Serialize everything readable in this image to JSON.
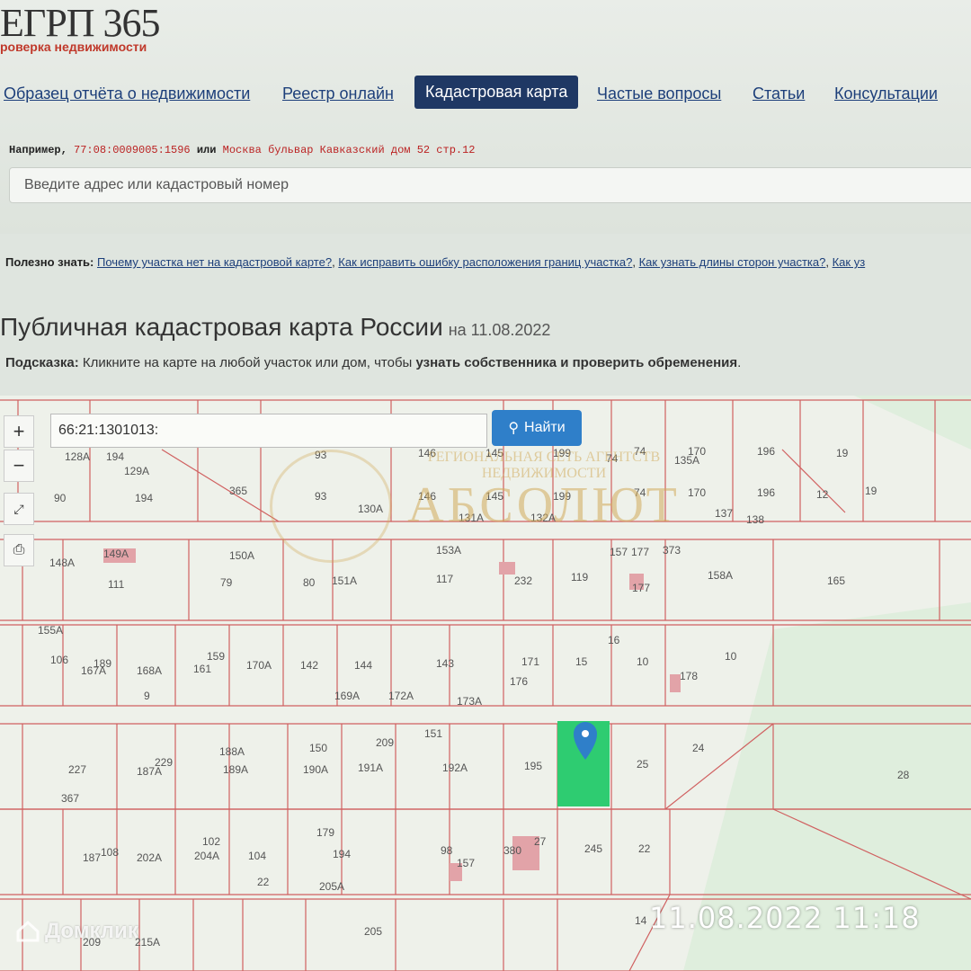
{
  "logo": {
    "title": "ЕГРП 365",
    "subtitle": "роверка недвижимости"
  },
  "nav": {
    "items": [
      {
        "label": "Образец отчёта о недвижимости"
      },
      {
        "label": "Реестр онлайн"
      },
      {
        "label": "Кадастровая карта"
      },
      {
        "label": "Частые вопросы"
      },
      {
        "label": "Статьи"
      },
      {
        "label": "Консультации"
      }
    ]
  },
  "example": {
    "prefix": "Например,",
    "code": "77:08:0009005:1596",
    "or": "или",
    "address": "Москва бульвар Кавказский дом 52 стр.12"
  },
  "search": {
    "placeholder": "Введите адрес или кадастровый номер"
  },
  "useful": {
    "label": "Полезно знать:",
    "links": [
      "Почему участка нет на кадастровой карте?",
      "Как исправить ошибку расположения границ участка?",
      "Как узнать длины сторон участка?",
      "Как уз"
    ]
  },
  "title": {
    "text": "Публичная кадастровая карта России",
    "date": "на 11.08.2022"
  },
  "hint": {
    "label": "Подсказка:",
    "text": "Кликните на карте на любой участок или дом, чтобы",
    "bold": "узнать собственника и проверить обременения"
  },
  "map": {
    "search_value": "66:21:1301013:",
    "find_label": "Найти",
    "zoom_in": "+",
    "zoom_out": "−",
    "watermark_line": "РЕГИОНАЛЬНАЯ СЕТЬ АГЕНТСТВ НЕДВИЖИМОСТИ",
    "watermark_brand": "АБСОЛЮТ",
    "parcels": [
      "128А",
      "194",
      "129А",
      "90",
      "194",
      "93",
      "146",
      "145",
      "199",
      "74",
      "74",
      "170",
      "196",
      "19",
      "135А",
      "93",
      "130А",
      "146",
      "145",
      "199",
      "74",
      "170",
      "196",
      "12",
      "19",
      "131А",
      "132А",
      "137",
      "138",
      "365",
      "148А",
      "149А",
      "111",
      "150А",
      "79",
      "80",
      "151А",
      "153А",
      "117",
      "232",
      "119",
      "157",
      "177",
      "177",
      "373",
      "158А",
      "165",
      "155А",
      "106",
      "167А",
      "189",
      "168А",
      "161",
      "159",
      "170А",
      "142",
      "144",
      "143",
      "171",
      "15",
      "16",
      "10",
      "10",
      "9",
      "169А",
      "172А",
      "173А",
      "176",
      "178",
      "227",
      "187А",
      "229",
      "188А",
      "189А",
      "150",
      "190А",
      "209",
      "191А",
      "151",
      "192А",
      "195",
      "25",
      "24",
      "28",
      "367",
      "187",
      "108",
      "202А",
      "102",
      "204А",
      "104",
      "179",
      "194",
      "98",
      "157",
      "380",
      "27",
      "245",
      "22",
      "22",
      "205А",
      "205",
      "209",
      "215А",
      "14"
    ]
  },
  "overlay": {
    "timestamp": "11.08.2022 11:18",
    "brand": "Домклик"
  },
  "colors": {
    "nav_active": "#1f3864",
    "find_btn": "#2f7fc9",
    "parcel_line": "#d06060",
    "selected_parcel": "#2ecc71"
  }
}
